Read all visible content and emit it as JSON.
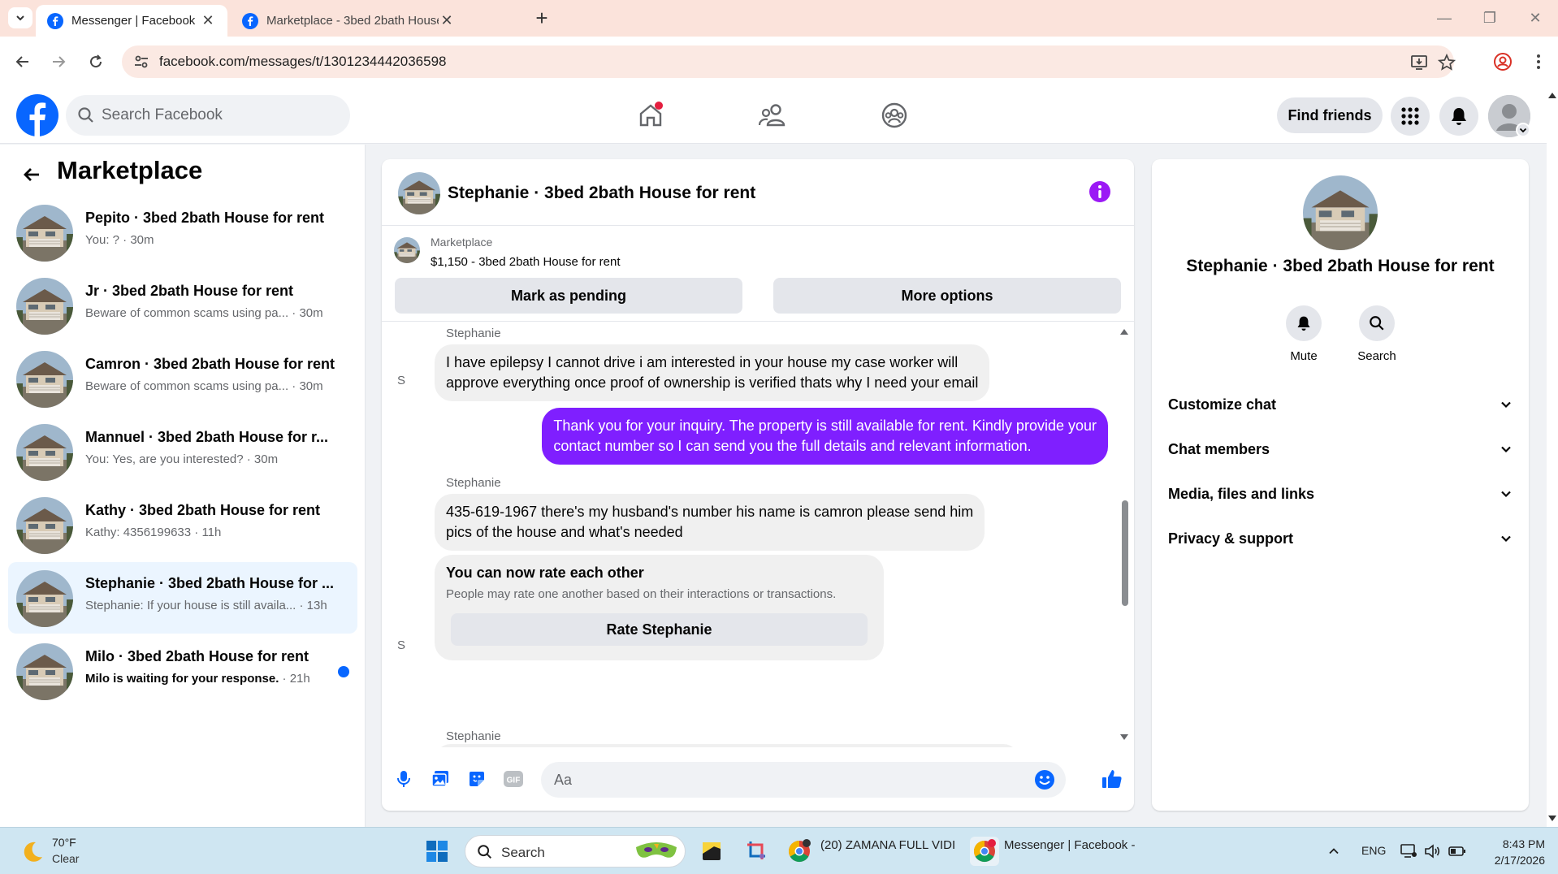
{
  "browser": {
    "tabs": [
      {
        "title": "Messenger | Facebook",
        "active": true
      },
      {
        "title": "Marketplace - 3bed 2bath House for rent",
        "active": false
      }
    ],
    "url": "facebook.com/messages/t/1301234442036598"
  },
  "header": {
    "search_placeholder": "Search Facebook",
    "find_friends_label": "Find friends"
  },
  "left_pane": {
    "title": "Marketplace",
    "conversations": [
      {
        "name": "Pepito · 3bed 2bath House for rent",
        "preview": "You: ? · 30m",
        "selected": false,
        "unread": false
      },
      {
        "name": "Jr · 3bed 2bath House for rent",
        "preview": "Beware of common scams using pa... · 30m",
        "selected": false,
        "unread": false
      },
      {
        "name": "Camron · 3bed 2bath House for rent",
        "preview": "Beware of common scams using pa... · 30m",
        "selected": false,
        "unread": false
      },
      {
        "name": "Mannuel · 3bed 2bath House for r...",
        "preview": "You: Yes, are you interested? · 30m",
        "selected": false,
        "unread": false
      },
      {
        "name": "Kathy · 3bed 2bath House for rent",
        "preview": "Kathy: 4356199633 · 11h",
        "selected": false,
        "unread": false
      },
      {
        "name": "Stephanie · 3bed 2bath House for ...",
        "preview": "Stephanie: If your house is still availa... · 13h",
        "selected": true,
        "unread": false
      },
      {
        "name": "Milo · 3bed 2bath House for rent",
        "preview": "Milo is waiting for your response.",
        "time": " · 21h",
        "selected": false,
        "unread": true
      }
    ]
  },
  "chat": {
    "title": "Stephanie · 3bed 2bath House for rent",
    "marketplace_label": "Marketplace",
    "listing": "$1,150 - 3bed 2bath House for rent",
    "mark_pending_label": "Mark as pending",
    "more_options_label": "More options",
    "messages": {
      "m1_sender": "Stephanie",
      "m1_line1": "I have epilepsy I cannot drive i am interested in your house my case worker will",
      "m1_line2": "approve everything once proof of ownership is verified thats why I need your email",
      "m2_line1": "Thank you for your inquiry. The property is still available for rent. Kindly provide your",
      "m2_line2": "contact number so I can send you the full details and relevant information.",
      "m3_sender": "Stephanie",
      "m3_line1": "435-619-1967 there's my husband's number his name is camron please send him",
      "m3_line2": "pics of the house and what's needed",
      "m5_sender": "Stephanie",
      "avatar_alt": "S"
    },
    "rate_card": {
      "title": "You can now rate each other",
      "desc": "People may rate one another based on their interactions or transactions.",
      "button": "Rate Stephanie"
    },
    "composer_placeholder": "Aa"
  },
  "right_pane": {
    "name": "Stephanie · 3bed 2bath House for rent",
    "mute_label": "Mute",
    "search_label": "Search",
    "sections": [
      "Customize chat",
      "Chat members",
      "Media, files and links",
      "Privacy & support"
    ]
  },
  "taskbar": {
    "temp": "70°F",
    "condition": "Clear",
    "search_label": "Search",
    "app1": "(20) ZAMANA FULL VIDI",
    "app2": "Messenger | Facebook -",
    "lang": "ENG",
    "time": "8:43 PM",
    "date": "2/17/2026"
  },
  "colors": {
    "fb_blue": "#0866ff",
    "outgoing_bubble": "#7f1fff",
    "selected_row": "#ebf5ff",
    "info_icon": "#9b19f5"
  }
}
